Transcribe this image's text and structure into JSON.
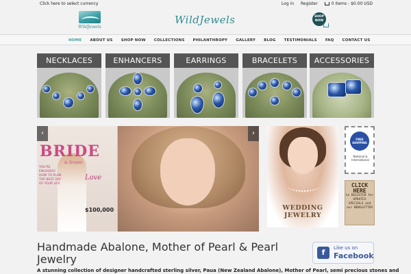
{
  "topbar": {
    "currency": "Click here to select currency",
    "login": "Log in",
    "register": "Register",
    "cart_text": "0 items - $0.00 USD"
  },
  "header": {
    "logo_small": "WildJewels",
    "brand": "WildJewels",
    "shop_now": "SHOP NOW"
  },
  "nav": {
    "items": [
      {
        "label": "HOME"
      },
      {
        "label": "ABOUT US"
      },
      {
        "label": "SHOP NOW"
      },
      {
        "label": "COLLECTIONS"
      },
      {
        "label": "PHILANTHROPY"
      },
      {
        "label": "GALLERY"
      },
      {
        "label": "BLOG"
      },
      {
        "label": "TESTIMONIALS"
      },
      {
        "label": "FAQ"
      },
      {
        "label": "CONTACT US"
      }
    ],
    "active_index": 0,
    "active_color": "#3b9aa0"
  },
  "categories": [
    {
      "label": "NECKLACES"
    },
    {
      "label": "ENHANCERS"
    },
    {
      "label": "EARRINGS"
    },
    {
      "label": "BRACELETS"
    },
    {
      "label": "ACCESSORIES"
    }
  ],
  "slider": {
    "prev_icon": "chevron-left-icon",
    "next_icon": "chevron-right-icon",
    "magazine_title": "BRIDE",
    "magazine_sub": "& Groom",
    "magazine_side": "YOU'RE ENGAGED! HOW TO PLAN THE BEST DAY OF YOUR LIFE",
    "magazine_love": "Love",
    "magazine_price": "$100,000"
  },
  "right_panel": {
    "wedding_text": "WEDDING JEWELRY",
    "stamp_badge": "FREE SHIPPING",
    "stamp_text": "National & International",
    "click_big": "CLICK HERE",
    "click_small": "to REGISTER for UPDATES SPECIALS and our NEWSLETTER"
  },
  "main": {
    "headline": "Handmade Abalone, Mother of Pearl & Pearl Jewelry",
    "tagline": "A stunning collection of designer handcrafted sterling silver, Paua (New Zealand Abalone), Mother of Pearl, semi precious stones and"
  },
  "facebook": {
    "like_text": "Like us on",
    "brand": "Facebook"
  },
  "colors": {
    "teal": "#2f8b8f",
    "tile_label_bg": "#555555",
    "facebook_blue": "#3b5998"
  }
}
